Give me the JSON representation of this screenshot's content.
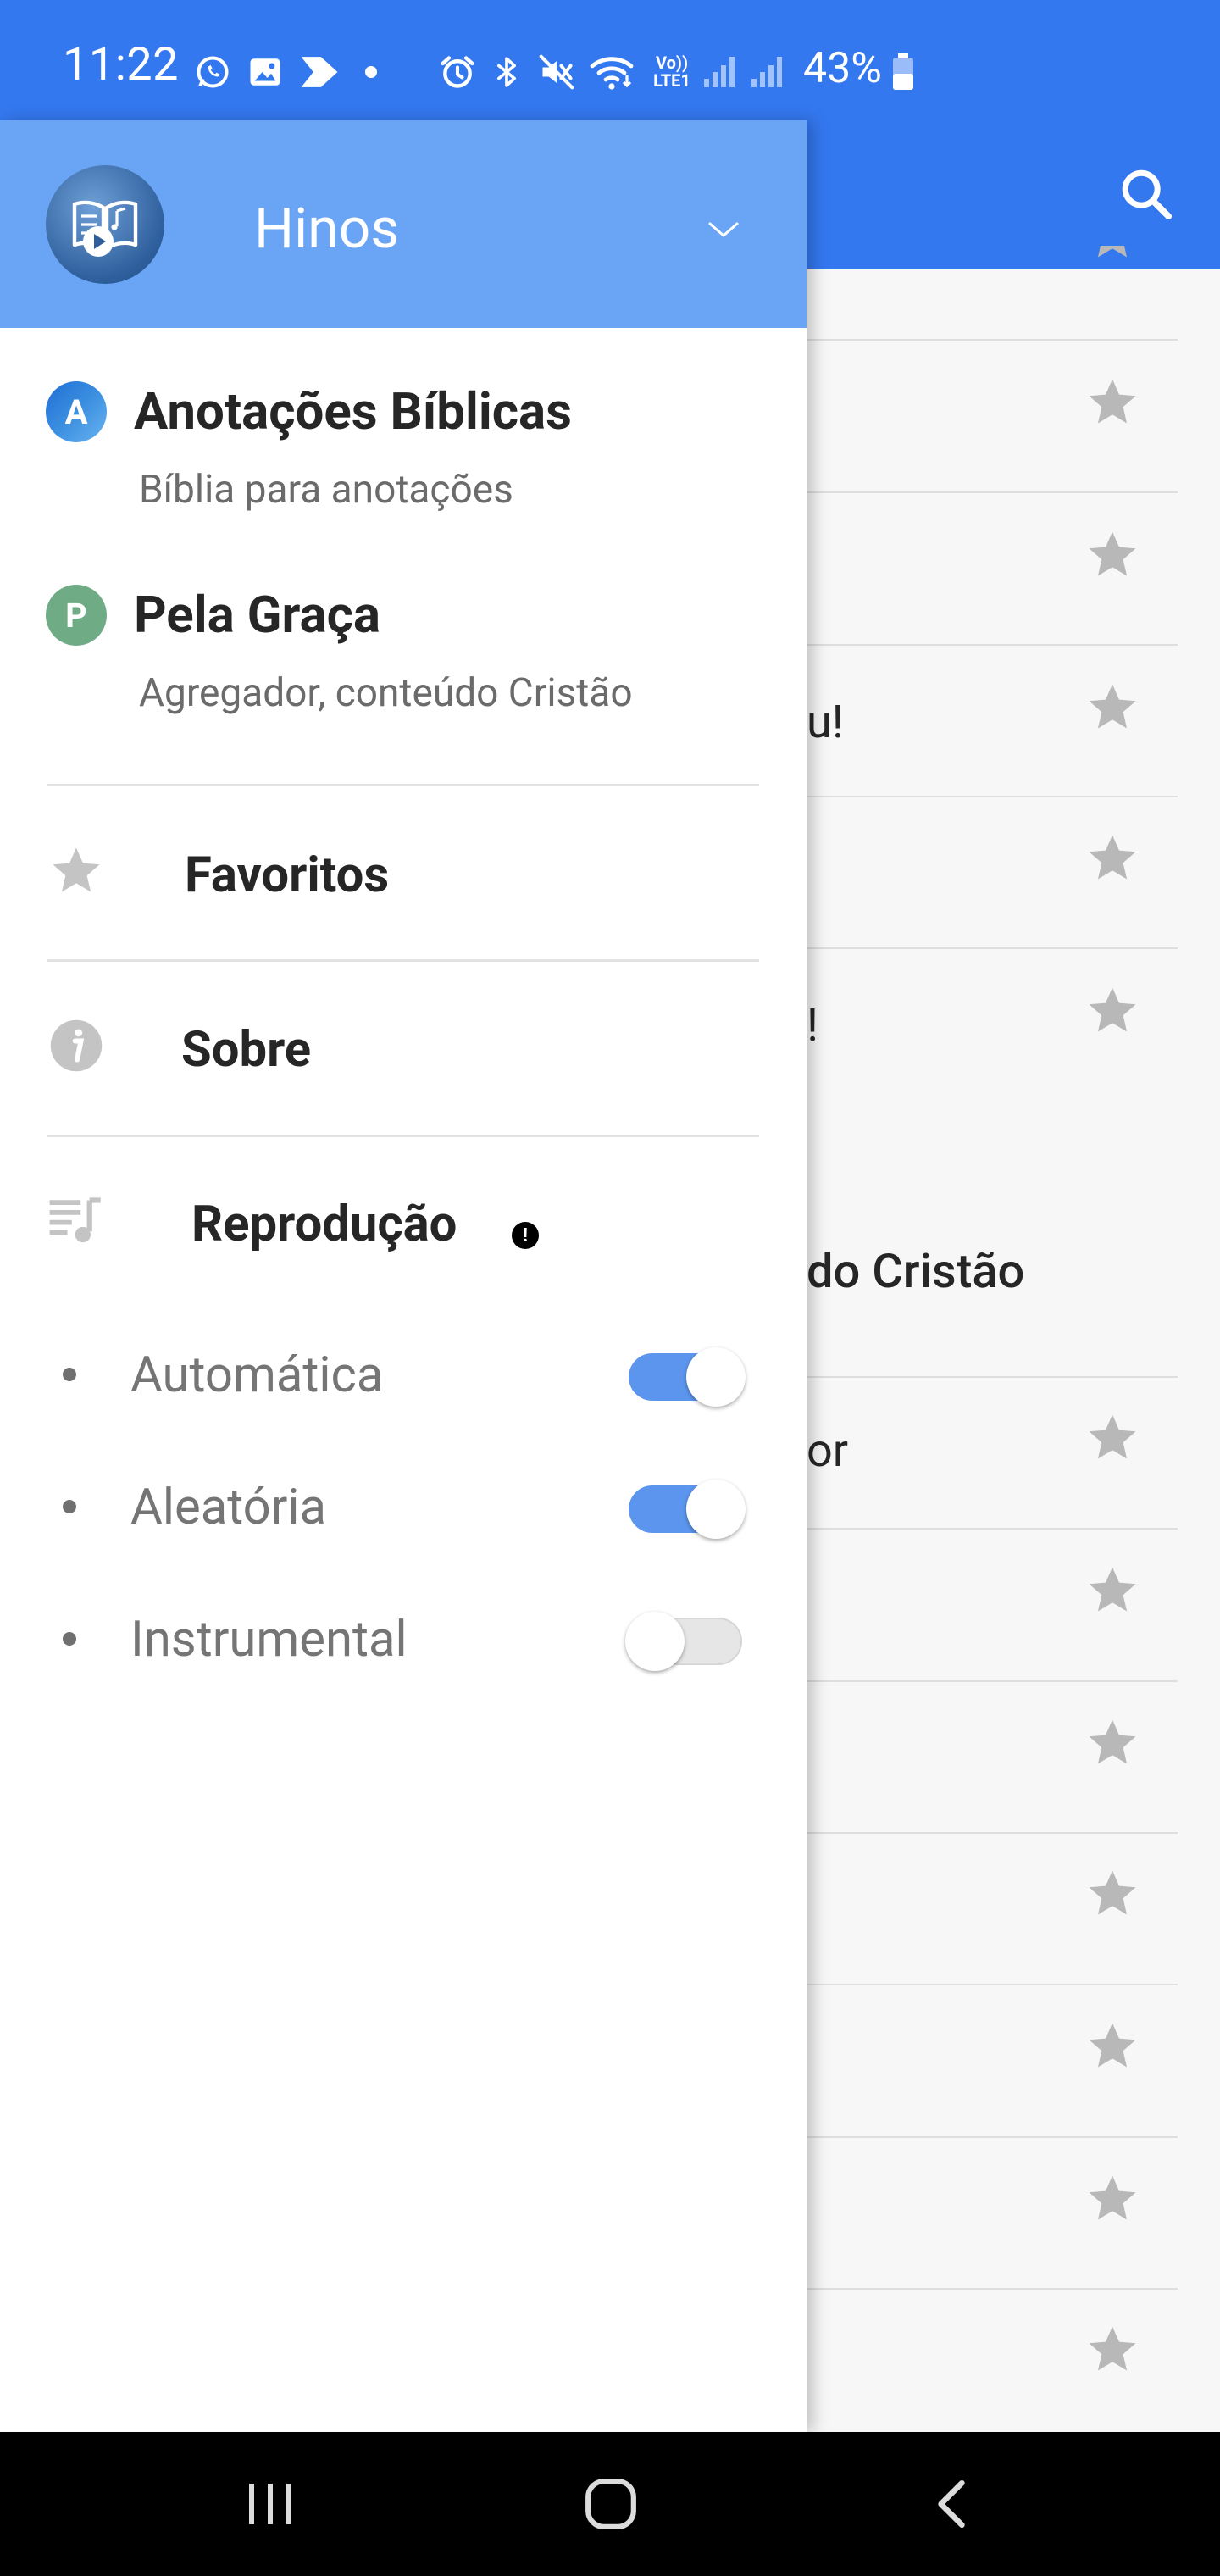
{
  "status_bar": {
    "time": "11:22",
    "battery_percent": "43%",
    "icons": [
      "whatsapp-icon",
      "gallery-icon",
      "arrow-icon",
      "dot-icon",
      "alarm-icon",
      "bluetooth-icon",
      "mute-icon",
      "wifi-icon",
      "volte-icon",
      "signal-icon",
      "signal-icon",
      "battery-icon"
    ],
    "volte_label": "Vo))",
    "lte_label": "LTE1"
  },
  "drawer": {
    "title": "Hinos",
    "links": [
      {
        "badge": "A",
        "title": "Anotações Bíblicas",
        "subtitle": "Bíblia para anotações",
        "badge_color": "#3b8fe0"
      },
      {
        "badge": "P",
        "title": "Pela Graça",
        "subtitle": "Agregador, conteúdo Cristão",
        "badge_color": "#6fac86"
      }
    ],
    "menu": {
      "favorites": "Favoritos",
      "about": "Sobre",
      "playback": "Reprodução",
      "alert": "!"
    },
    "playback_options": [
      {
        "label": "Automática",
        "enabled": true
      },
      {
        "label": "Aleatória",
        "enabled": true
      },
      {
        "label": "Instrumental",
        "enabled": false
      }
    ]
  },
  "background_list": {
    "visible_fragments": [
      "u!",
      "!",
      "do Cristão",
      "or"
    ]
  },
  "colors": {
    "primary": "#3478f0",
    "drawer_header": "#6aa5f5",
    "toggle_on": "#5b95ee",
    "star": "#b8b8b8"
  }
}
